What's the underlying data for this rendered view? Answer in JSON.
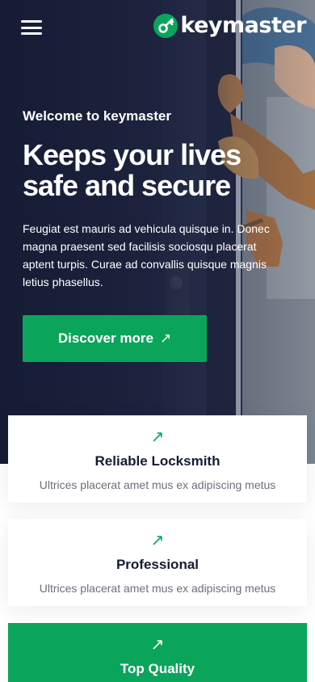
{
  "header": {
    "logo_text": "keymaster",
    "brand_color": "#0aa55a",
    "menu_icon": "hamburger-menu-icon",
    "logo_icon": "key-logo-icon"
  },
  "hero": {
    "eyebrow": "Welcome to keymaster",
    "headline": "Keeps your lives safe and secure",
    "description": "Feugiat est mauris ad vehicula quisque in. Donec magna praesent sed facilisis sociosqu placerat aptent turpis. Curae ad convallis quisque magnis letius phasellus.",
    "cta_label": "Discover more",
    "cta_arrow": "↗"
  },
  "features": [
    {
      "icon": "↗",
      "title": "Reliable Locksmith",
      "description": "Ultrices placerat amet mus ex adipiscing metus"
    },
    {
      "icon": "↗",
      "title": "Professional",
      "description": "Ultrices placerat amet mus ex adipiscing metus"
    },
    {
      "icon": "↗",
      "title": "Top Quality"
    }
  ]
}
